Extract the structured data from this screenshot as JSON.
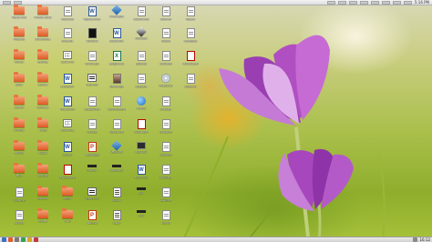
{
  "top_panel": {
    "clock": "5:16 PM"
  },
  "bottom_panel": {
    "tray_text": "16:12"
  },
  "desktop_icons": [
    {
      "type": "folder",
      "label": "Music files"
    },
    {
      "type": "folder",
      "label": "Photos 2015"
    },
    {
      "type": "doc",
      "label": "notes.txt"
    },
    {
      "type": "word",
      "label": "Report.docx"
    },
    {
      "type": "diamond",
      "label": "VirtualBox"
    },
    {
      "type": "doc",
      "label": "readme.txt"
    },
    {
      "type": "doc",
      "label": "todo.txt"
    },
    {
      "type": "doc",
      "label": "log.txt"
    },
    {
      "type": "folder",
      "label": "Projects"
    },
    {
      "type": "folder",
      "label": "Downloads"
    },
    {
      "type": "doc",
      "label": "draft.txt"
    },
    {
      "type": "blackdoc",
      "label": "Terminal"
    },
    {
      "type": "word",
      "label": "Letter.doc"
    },
    {
      "type": "diamond-dark",
      "label": "Inkscape"
    },
    {
      "type": "doc",
      "label": "list.txt"
    },
    {
      "type": "doc",
      "label": "config.txt"
    },
    {
      "type": "folder",
      "label": "Videos"
    },
    {
      "type": "folder",
      "label": "Backup"
    },
    {
      "type": "sheet",
      "label": "table.ods"
    },
    {
      "type": "doc",
      "label": "memo.txt"
    },
    {
      "type": "excel",
      "label": "Budget.xls"
    },
    {
      "type": "doc",
      "label": "plan.txt"
    },
    {
      "type": "doc",
      "label": "index.txt"
    },
    {
      "type": "pdf",
      "label": "Manual.pdf"
    },
    {
      "type": "folder",
      "label": "Work"
    },
    {
      "type": "folder",
      "label": "Games"
    },
    {
      "type": "word",
      "label": "Essay.doc"
    },
    {
      "type": "bars",
      "label": "data.csv"
    },
    {
      "type": "photo",
      "label": "photo.jpg"
    },
    {
      "type": "doc",
      "label": "story.txt"
    },
    {
      "type": "disk",
      "label": "image.iso"
    },
    {
      "type": "doc",
      "label": "script.sh"
    },
    {
      "type": "folder",
      "label": "School"
    },
    {
      "type": "folder",
      "label": "Old files"
    },
    {
      "type": "word",
      "label": "Thesis.doc"
    },
    {
      "type": "doc",
      "label": "chapter.txt"
    },
    {
      "type": "doc",
      "label": "summary.txt"
    },
    {
      "type": "globe",
      "label": "Firefox"
    },
    {
      "type": "doc",
      "label": "links.txt"
    },
    {
      "type": "folder",
      "label": "Archive"
    },
    {
      "type": "folder",
      "label": "Temp"
    },
    {
      "type": "sheet",
      "label": "sheet.ods"
    },
    {
      "type": "doc",
      "label": "info.txt"
    },
    {
      "type": "doc",
      "label": "notes2.txt"
    },
    {
      "type": "pdf",
      "label": "Guide.pdf"
    },
    {
      "type": "doc",
      "label": "tasks.txt"
    },
    {
      "type": "folder",
      "label": "Books"
    },
    {
      "type": "folder",
      "label": "Scans"
    },
    {
      "type": "word",
      "label": "CV.doc"
    },
    {
      "type": "ppt",
      "label": "Slides.ppt"
    },
    {
      "type": "diamond",
      "label": "VBox VM"
    },
    {
      "type": "dark-screen",
      "label": "Console"
    },
    {
      "type": "doc",
      "label": "ideas.txt"
    },
    {
      "type": "folder",
      "label": "Misc"
    },
    {
      "type": "folder",
      "label": "Shared"
    },
    {
      "type": "pdf",
      "label": "Invoice.pdf"
    },
    {
      "type": "dash",
      "label": "divider"
    },
    {
      "type": "dash",
      "label": "separator"
    },
    {
      "type": "word",
      "label": "Form.doc"
    },
    {
      "type": "doc",
      "label": "keys.txt"
    },
    {
      "type": "doc",
      "label": "hosts.txt"
    },
    {
      "type": "folder",
      "label": "Camera"
    },
    {
      "type": "folder",
      "label": "Phone"
    },
    {
      "type": "bars",
      "label": "export.csv"
    },
    {
      "type": "stack",
      "label": "layers"
    },
    {
      "type": "dash",
      "label": "line"
    },
    {
      "type": "doc",
      "label": "spec.txt"
    },
    {
      "type": "doc",
      "label": "api.txt"
    },
    {
      "type": "folder",
      "label": "Drafts"
    },
    {
      "type": "folder",
      "label": "Mail"
    },
    {
      "type": "ppt",
      "label": "Talk.ppt"
    },
    {
      "type": "stack",
      "label": "stack"
    },
    {
      "type": "dash",
      "label": "rule"
    },
    {
      "type": "doc",
      "label": "bio.txt"
    },
    {
      "type": "doc",
      "label": "diary.txt"
    }
  ]
}
